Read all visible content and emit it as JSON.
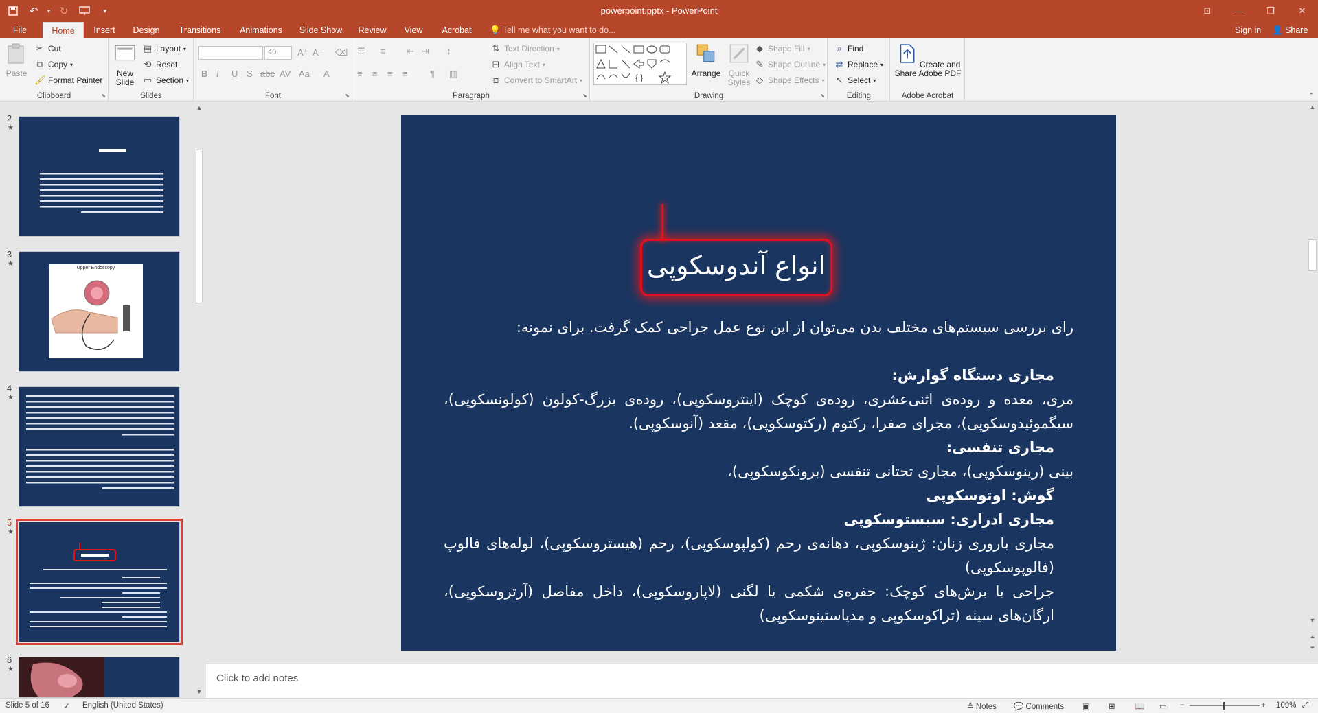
{
  "window": {
    "title": "powerpoint.pptx - PowerPoint"
  },
  "tabs": [
    {
      "label": "File"
    },
    {
      "label": "Home"
    },
    {
      "label": "Insert"
    },
    {
      "label": "Design"
    },
    {
      "label": "Transitions"
    },
    {
      "label": "Animations"
    },
    {
      "label": "Slide Show"
    },
    {
      "label": "Review"
    },
    {
      "label": "View"
    },
    {
      "label": "Acrobat"
    }
  ],
  "tell_me": "Tell me what you want to do...",
  "sign_in": "Sign in",
  "share": "Share",
  "ribbon": {
    "clipboard": {
      "label": "Clipboard",
      "paste": "Paste",
      "cut": "Cut",
      "copy": "Copy",
      "format_painter": "Format Painter"
    },
    "slides": {
      "label": "Slides",
      "new_slide": "New Slide",
      "layout": "Layout",
      "reset": "Reset",
      "section": "Section"
    },
    "font": {
      "label": "Font",
      "size": "40"
    },
    "paragraph": {
      "label": "Paragraph",
      "text_direction": "Text Direction",
      "align_text": "Align Text",
      "convert_smartart": "Convert to SmartArt"
    },
    "drawing": {
      "label": "Drawing",
      "arrange": "Arrange",
      "quick_styles": "Quick Styles",
      "shape_fill": "Shape Fill",
      "shape_outline": "Shape Outline",
      "shape_effects": "Shape Effects"
    },
    "editing": {
      "label": "Editing",
      "find": "Find",
      "replace": "Replace",
      "select": "Select"
    },
    "acrobat": {
      "label": "Adobe Acrobat",
      "create_share": "Create and Share Adobe PDF"
    }
  },
  "thumbnails": [
    {
      "number": "2",
      "star": "★"
    },
    {
      "number": "3",
      "star": "★",
      "image_label": "Upper Endoscopy"
    },
    {
      "number": "4",
      "star": "★"
    },
    {
      "number": "5",
      "star": "★"
    },
    {
      "number": "6",
      "star": "★"
    }
  ],
  "slide": {
    "title": "انواع آندوسکوپی",
    "lines": [
      {
        "text": "رای بررسی سیستم‌های مختلف بدن می‌توان از این نوع عمل جراحی کمک گرفت. برای نمونه:",
        "bold": false
      },
      {
        "text": "",
        "bold": false
      },
      {
        "text": "مجاری دستگاه گوارش:",
        "bold": true
      },
      {
        "text": "مری، معده و روده‌ی اثنی‌عشری، روده‌ی کوچک (اینتروسکوپی)، روده‌ی بزرگ-کولون (کولونسکوپی)، سیگموئیدوسکوپی)، مجرای صفرا، رکتوم (رکتوسکوپی)، مقعد (آنوسکوپی).",
        "bold": false
      },
      {
        "text": "مجاری تنفسی:",
        "bold": true
      },
      {
        "text": "بینی (رینوسکوپی)، مجاری تحتانی تنفسی (برونکوسکوپی)،",
        "bold": false
      },
      {
        "text": "گوش: اوتوسکوپی",
        "bold": false
      },
      {
        "text": "مجاری ادراری: سیستوسکوپی",
        "bold": false
      },
      {
        "text": "مجاری باروری زنان: ژینوسکوپی، دهانه‌ی رحم (کولپوسکوپی)، رحم (هیستروسکوپی)، لوله‌های فالوپ (فالوپوسکوپی)",
        "bold": false
      },
      {
        "text": "جراحی با برش‌های کوچک: حفره‌ی شکمی یا لگنی (لاپاروسکوپی)، داخل مفاصل (آرتروسکوپی)، ارگان‌های سینه (تراکوسکوپی و مدیاستینوسکوپی)",
        "bold": false
      }
    ]
  },
  "notes_placeholder": "Click to add notes",
  "status": {
    "slide_info": "Slide 5 of 16",
    "language": "English (United States)",
    "notes": "Notes",
    "comments": "Comments",
    "zoom": "109%"
  },
  "colors": {
    "accent": "#b7472a",
    "slide_bg": "#1a3660",
    "title_border": "#e3101b"
  }
}
